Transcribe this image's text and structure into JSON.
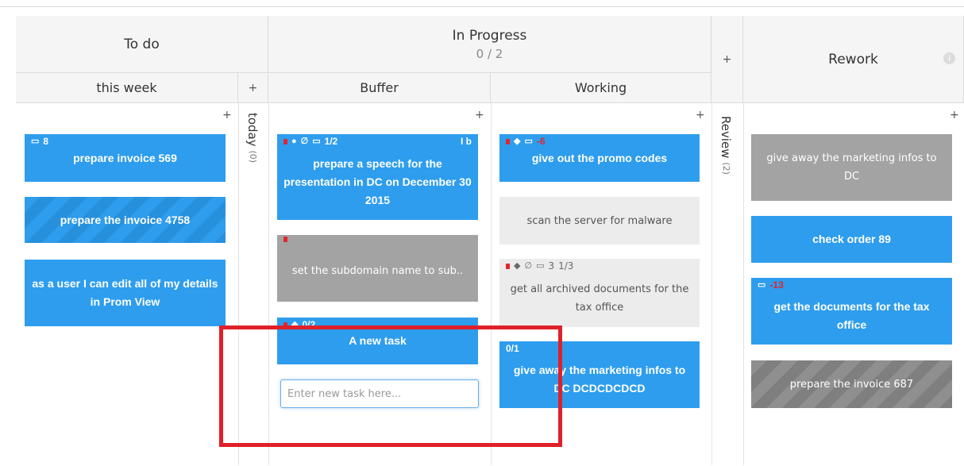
{
  "columns": {
    "todo": {
      "title": "To do",
      "sub_this_week": "this week",
      "today_label": "today",
      "today_count": "(0)"
    },
    "in_progress": {
      "title": "In Progress",
      "wip": "0 / 2",
      "buffer": "Buffer",
      "working": "Working"
    },
    "review": {
      "label": "Review",
      "count": "(2)"
    },
    "rework": {
      "title": "Rework",
      "info": "i"
    }
  },
  "plus": "+",
  "cards": {
    "c1": {
      "meta": "8",
      "title": "prepare invoice 569"
    },
    "c2": {
      "title": "prepare the invoice 4758"
    },
    "c3": {
      "title": "as a user I can edit all of my details in Prom View"
    },
    "b1": {
      "meta": "1/2",
      "meta_right": "I b",
      "title": "prepare a speech for the presentation in DC on December 30 2015"
    },
    "b2": {
      "title": "set the subdomain name to sub.."
    },
    "b3": {
      "meta": "0/2",
      "title": "A new task"
    },
    "w1": {
      "meta": "-6",
      "title": "give out the promo codes"
    },
    "w2": {
      "title": "scan the server for malware"
    },
    "w3": {
      "meta_a": "3",
      "meta_b": "1/3",
      "title": "get all archived documents for the tax office"
    },
    "w4": {
      "meta": "0/1",
      "title": "give away the marketing infos to DC DCDCDCDCD"
    },
    "r1": {
      "title": "give away the marketing infos to DC"
    },
    "r2": {
      "title": "check order 89"
    },
    "r3": {
      "meta": "-13",
      "title": "get the documents for the tax office"
    },
    "r4": {
      "title": "prepare the invoice 687"
    }
  },
  "new_task": {
    "placeholder": "Enter new task here..."
  },
  "colors": {
    "card_blue": "#2e9ded",
    "card_grey": "#a3a3a3",
    "highlight": "#e02029"
  },
  "icons": [
    "calendar-icon",
    "plus-icon",
    "comment-icon",
    "attachment-icon",
    "tag-icon",
    "info-icon"
  ]
}
